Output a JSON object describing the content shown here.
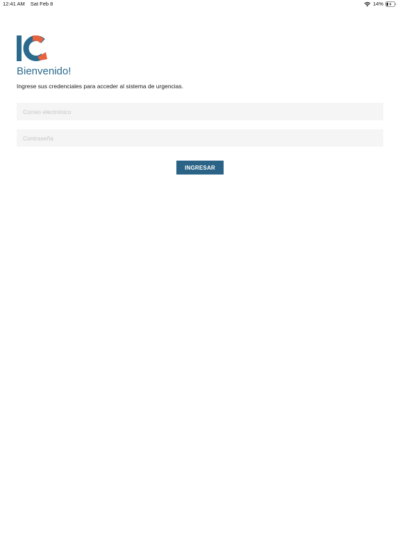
{
  "status_bar": {
    "time": "12:41 AM",
    "date": "Sat Feb 8",
    "battery": "14%",
    "icons": [
      "wifi-icon",
      "battery-charging-icon"
    ]
  },
  "brand": {
    "logo_text": "IC",
    "colors": {
      "blue": "#2b6a8c",
      "orange": "#e8623e"
    }
  },
  "login": {
    "title": "Bienvenido!",
    "subtitle": "Ingrese sus credenciales para acceder al sistema de urgencias.",
    "email_placeholder": "Correo electrónico",
    "email_value": "",
    "password_placeholder": "Contraseña",
    "password_value": "",
    "submit_label": "INGRESAR"
  },
  "colors": {
    "accent": "#2a6385",
    "field_background": "#f5f5f5",
    "placeholder": "#c6c6c6"
  }
}
